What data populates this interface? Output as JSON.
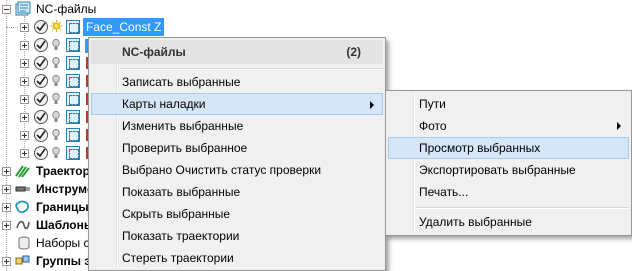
{
  "tree": {
    "root_label": "NC-файлы",
    "selected_item": "Face_Const Z",
    "bottom_items": [
      {
        "label": "Траектор",
        "bold": true,
        "icon": "toolpath-icon"
      },
      {
        "label": "Инструме",
        "bold": true,
        "icon": "tool-icon"
      },
      {
        "label": "Границы",
        "bold": true,
        "icon": "boundary-icon"
      },
      {
        "label": "Шаблоны",
        "bold": true,
        "icon": "pattern-icon"
      },
      {
        "label": "Наборы с",
        "bold": false,
        "icon": "feature-set-icon"
      },
      {
        "label": "Группы э",
        "bold": true,
        "icon": "groups-icon"
      }
    ]
  },
  "context_menu": {
    "header_label": "NC-файлы",
    "header_count": "(2)",
    "items": [
      {
        "label": "Записать выбранные"
      },
      {
        "label": "Карты наладки"
      },
      {
        "label": "Изменить выбранные"
      },
      {
        "label": "Проверить выбранное"
      },
      {
        "label": "Выбрано Очистить статус проверки"
      },
      {
        "label": "Показать выбранные"
      },
      {
        "label": "Скрыть выбранные"
      },
      {
        "label": "Показать траектории"
      },
      {
        "label": "Стереть траектории"
      }
    ]
  },
  "submenu": {
    "items": [
      {
        "label": "Пути"
      },
      {
        "label": "Фото"
      },
      {
        "label": "Просмотр выбранных"
      },
      {
        "label": "Экспортировать выбранные"
      },
      {
        "label": "Печать..."
      },
      {
        "label": "Удалить выбранные"
      }
    ]
  },
  "colors": {
    "selection": "#3399ff",
    "menu_highlight": "#d5e6f7",
    "menu_bg": "#f0f0f0"
  }
}
